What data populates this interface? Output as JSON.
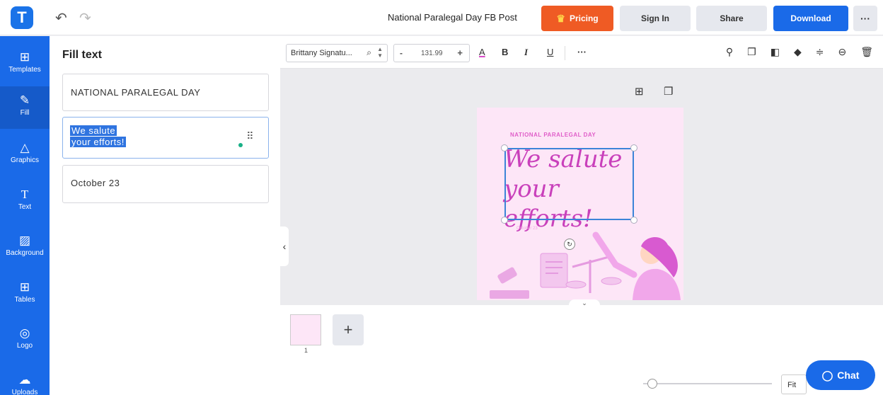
{
  "header": {
    "logo_letter": "T",
    "undo_icon": "undo-icon",
    "redo_icon": "redo-icon",
    "doc_title": "National Paralegal Day FB Post",
    "pricing_label": "Pricing",
    "signin_label": "Sign In",
    "share_label": "Share",
    "download_label": "Download",
    "more_label": "···"
  },
  "sidebar": {
    "items": [
      {
        "label": "Templates",
        "icon": "templates-icon"
      },
      {
        "label": "Fill",
        "icon": "pen-icon"
      },
      {
        "label": "Graphics",
        "icon": "graphics-icon"
      },
      {
        "label": "Text",
        "icon": "text-icon"
      },
      {
        "label": "Background",
        "icon": "background-icon"
      },
      {
        "label": "Tables",
        "icon": "tables-icon"
      },
      {
        "label": "Logo",
        "icon": "logo-icon"
      },
      {
        "label": "Uploads",
        "icon": "upload-icon"
      }
    ],
    "active": "Fill"
  },
  "fill_panel": {
    "title": "Fill text",
    "fields": [
      {
        "value": "NATIONAL PARALEGAL DAY"
      },
      {
        "line1": "We salute",
        "line2": "your efforts!"
      },
      {
        "value": "October 23"
      }
    ]
  },
  "toolbar": {
    "font_name": "Brittany Signatu...",
    "font_size": "131.99",
    "minus": "-",
    "plus": "+",
    "color_glyph": "A",
    "bold_glyph": "B",
    "italic_glyph": "I",
    "underline_glyph": "U",
    "more_glyph": "···"
  },
  "artboard": {
    "heading": "NATIONAL PARALEGAL DAY",
    "script_line1": "We salute",
    "script_line2": "your efforts!",
    "date": "October 23"
  },
  "pages": {
    "thumb_number": "1",
    "add_label": "+"
  },
  "bottom": {
    "fit_label": "Fit",
    "chat_label": "Chat"
  },
  "colors": {
    "brand_blue": "#1a6ae8",
    "pricing_orange": "#ef5b24",
    "artboard_pink": "#fde6f7",
    "script_magenta": "#c940bb"
  }
}
